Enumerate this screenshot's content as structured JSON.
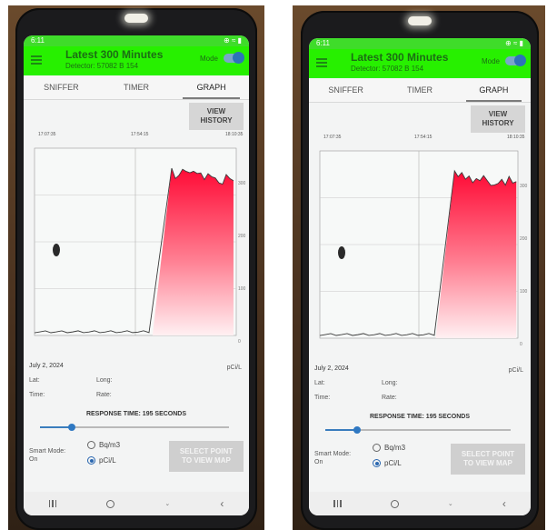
{
  "panels": [
    {
      "status": {
        "time": "6:11",
        "right": "⊕ ≈ ▮"
      },
      "app": {
        "title": "Latest 300 Minutes",
        "subtitle": "Detector: 57082 B 154",
        "mode_label": "Mode"
      },
      "tabs": [
        "SNIFFER",
        "TIMER",
        "GRAPH"
      ],
      "active_tab": 2,
      "history_button": "VIEW\nHISTORY",
      "time_labels": [
        "17:07:35",
        "17:54:15",
        "18:10:35"
      ],
      "y_ticks": [
        "300",
        "200",
        "100",
        "0"
      ],
      "date": "July 2, 2024",
      "unit": "pCi/L",
      "fields": {
        "lat": "Lat:",
        "long": "Long:",
        "time": "Time:",
        "rate": "Rate:"
      },
      "response_time": "RESPONSE TIME: 195 SECONDS",
      "slider_fraction": 0.17,
      "smart_mode": "Smart Mode:\nOn",
      "units_options": [
        "Bq/m3",
        "pCi/L"
      ],
      "selected_unit": 1,
      "select_button": "SELECT POINT\nTO VIEW MAP"
    },
    {
      "status": {
        "time": "6:11",
        "right": "⊕ ≈ ▮"
      },
      "app": {
        "title": "Latest 300 Minutes",
        "subtitle": "Detector: 57082 B 154",
        "mode_label": "Mode"
      },
      "tabs": [
        "SNIFFER",
        "TIMER",
        "GRAPH"
      ],
      "active_tab": 2,
      "history_button": "VIEW\nHISTORY",
      "time_labels": [
        "17:07:35",
        "17:54:15",
        "18:10:35"
      ],
      "y_ticks": [
        "300",
        "200",
        "100",
        "0"
      ],
      "date": "July 2, 2024",
      "unit": "pCi/L",
      "fields": {
        "lat": "Lat:",
        "long": "Long:",
        "time": "Time:",
        "rate": "Rate:"
      },
      "response_time": "RESPONSE TIME: 195 SECONDS",
      "slider_fraction": 0.17,
      "smart_mode": "Smart Mode:\nOn",
      "units_options": [
        "Bq/m3",
        "pCi/L"
      ],
      "selected_unit": 1,
      "select_button": "SELECT POINT\nTO VIEW MAP"
    }
  ],
  "colors": {
    "appbar": "#27f000",
    "fill_top": "#ff0d3a",
    "accent": "#2a67b0"
  },
  "icons": [
    "menu-icon",
    "toggle-switch",
    "recent-apps-icon",
    "home-icon",
    "back-icon"
  ]
}
